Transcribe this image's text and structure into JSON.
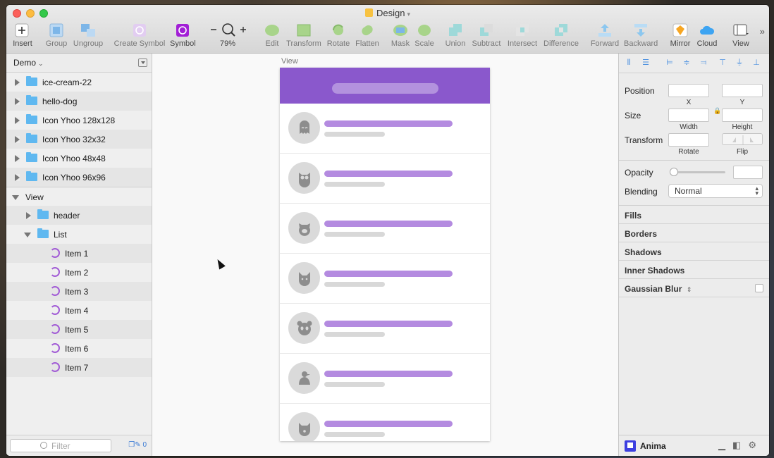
{
  "document": {
    "title": "Design"
  },
  "toolbar": {
    "items": [
      {
        "label": "Insert",
        "icon": "plus-icon"
      },
      {
        "label": "Group",
        "icon": "group-icon"
      },
      {
        "label": "Ungroup",
        "icon": "ungroup-icon"
      },
      {
        "label": "Create Symbol",
        "icon": "create-symbol-icon"
      },
      {
        "label": "Symbol",
        "icon": "symbol-icon"
      },
      {
        "label": "79%",
        "icon": "zoom-icon"
      },
      {
        "label": "Edit",
        "icon": "edit-icon"
      },
      {
        "label": "Transform",
        "icon": "transform-icon"
      },
      {
        "label": "Rotate",
        "icon": "rotate-icon"
      },
      {
        "label": "Flatten",
        "icon": "flatten-icon"
      },
      {
        "label": "Mask",
        "icon": "mask-icon"
      },
      {
        "label": "Scale",
        "icon": "scale-icon"
      },
      {
        "label": "Union",
        "icon": "union-icon"
      },
      {
        "label": "Subtract",
        "icon": "subtract-icon"
      },
      {
        "label": "Intersect",
        "icon": "intersect-icon"
      },
      {
        "label": "Difference",
        "icon": "difference-icon"
      },
      {
        "label": "Forward",
        "icon": "forward-icon"
      },
      {
        "label": "Backward",
        "icon": "backward-icon"
      },
      {
        "label": "Mirror",
        "icon": "mirror-icon"
      },
      {
        "label": "Cloud",
        "icon": "cloud-icon"
      },
      {
        "label": "View",
        "icon": "view-icon"
      }
    ]
  },
  "layers": {
    "page": "Demo",
    "top_folders": [
      "ice-cream-22",
      "hello-dog",
      "Icon Yhoo 128x128",
      "Icon Yhoo 32x32",
      "Icon Yhoo 48x48",
      "Icon Yhoo 96x96"
    ],
    "artboard": "View",
    "children": {
      "header": "header",
      "list": "List",
      "items": [
        "Item 1",
        "Item 2",
        "Item 3",
        "Item 4",
        "Item 5",
        "Item 6",
        "Item 7"
      ]
    },
    "filter_placeholder": "Filter",
    "slice_count": "0"
  },
  "canvas": {
    "artboard_label": "View",
    "accent": "#8a58cc",
    "line_color": "#b48be0",
    "rows": [
      {
        "icon": "ghost-icon"
      },
      {
        "icon": "owl-icon"
      },
      {
        "icon": "pig-icon"
      },
      {
        "icon": "cat-icon"
      },
      {
        "icon": "panda-icon"
      },
      {
        "icon": "bird-icon"
      },
      {
        "icon": "dog-icon"
      }
    ]
  },
  "inspector": {
    "position_label": "Position",
    "x_label": "X",
    "y_label": "Y",
    "size_label": "Size",
    "width_label": "Width",
    "height_label": "Height",
    "transform_label": "Transform",
    "rotate_label": "Rotate",
    "flip_label": "Flip",
    "opacity_label": "Opacity",
    "opacity_value": 0,
    "blending_label": "Blending",
    "blending_value": "Normal",
    "sections": [
      "Fills",
      "Borders",
      "Shadows",
      "Inner Shadows",
      "Gaussian Blur"
    ],
    "plugin_name": "Anima"
  }
}
